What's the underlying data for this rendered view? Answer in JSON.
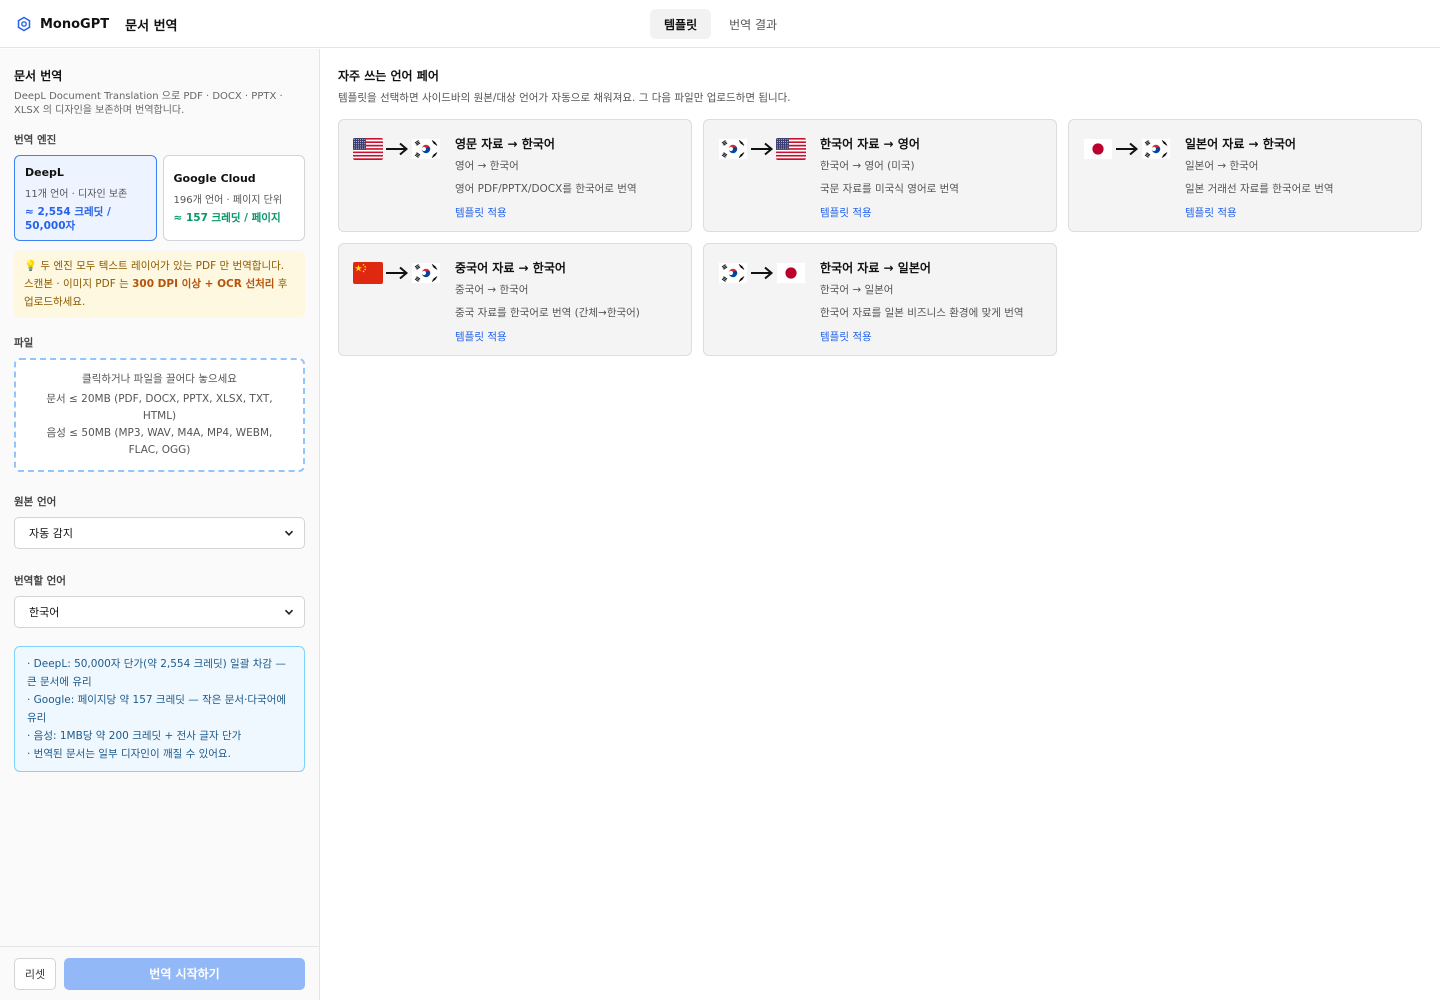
{
  "header": {
    "app_name": "MonoGPT",
    "page_title": "문서 번역",
    "tabs": [
      {
        "label": "템플릿",
        "active": true
      },
      {
        "label": "번역 결과",
        "active": false
      }
    ]
  },
  "sidebar": {
    "title": "문서 번역",
    "description": "DeepL Document Translation 으로 PDF · DOCX · PPTX · XLSX 의 디자인을 보존하며 번역합니다.",
    "engine_label": "번역 엔진",
    "engines": [
      {
        "name": "DeepL",
        "sub": "11개 언어 · 디자인 보존",
        "cost": "≈ 2,554 크레딧 / 50,000자",
        "selected": true
      },
      {
        "name": "Google Cloud",
        "sub": "196개 언어 · 페이지 단위",
        "cost": "≈ 157 크레딧 / 페이지",
        "selected": false
      }
    ],
    "warning": {
      "icon": "💡",
      "line1": "두 엔진 모두 텍스트 레이어가 있는 PDF 만 번역합니다. 스캔본 · 이미지 PDF 는 ",
      "strong": "300 DPI 이상 + OCR 선처리",
      "line2": " 후 업로드하세요."
    },
    "file_label": "파일",
    "dropzone": {
      "main": "클릭하거나 파일을 끌어다 놓으세요",
      "docs": "문서 ≤ 20MB (PDF, DOCX, PPTX, XLSX, TXT, HTML)",
      "audio": "음성 ≤ 50MB (MP3, WAV, M4A, MP4, WEBM, FLAC, OGG)"
    },
    "source_label": "원본 언어",
    "source_value": "자동 감지",
    "target_label": "번역할 언어",
    "target_value": "한국어",
    "info": [
      "· DeepL: 50,000자 단가(약 2,554 크레딧) 일괄 차감 — 큰 문서에 유리",
      "· Google: 페이지당 약 157 크레딧 — 작은 문서·다국어에 유리",
      "· 음성: 1MB당 약 200 크레딧 + 전사 글자 단가",
      "· 번역된 문서는 일부 디자인이 깨질 수 있어요."
    ],
    "reset_label": "리셋",
    "start_label": "번역 시작하기"
  },
  "main": {
    "title": "자주 쓰는 언어 페어",
    "description": "템플릿을 선택하면 사이드바의 원본/대상 언어가 자동으로 채워져요. 그 다음 파일만 업로드하면 됩니다.",
    "apply_label": "템플릿 적용",
    "templates": [
      {
        "from": "us",
        "to": "kr",
        "title": "영문 자료 → 한국어",
        "pair": "영어 → 한국어",
        "desc": "영어 PDF/PPTX/DOCX를 한국어로 번역"
      },
      {
        "from": "kr",
        "to": "us",
        "title": "한국어 자료 → 영어",
        "pair": "한국어 → 영어 (미국)",
        "desc": "국문 자료를 미국식 영어로 번역"
      },
      {
        "from": "jp",
        "to": "kr",
        "title": "일본어 자료 → 한국어",
        "pair": "일본어 → 한국어",
        "desc": "일본 거래선 자료를 한국어로 번역"
      },
      {
        "from": "cn",
        "to": "kr",
        "title": "중국어 자료 → 한국어",
        "pair": "중국어 → 한국어",
        "desc": "중국 자료를 한국어로 번역 (간체→한국어)"
      },
      {
        "from": "kr",
        "to": "jp",
        "title": "한국어 자료 → 일본어",
        "pair": "한국어 → 일본어",
        "desc": "한국어 자료를 일본 비즈니스 환경에 맞게 번역"
      }
    ]
  },
  "colors": {
    "accent": "#2563eb",
    "start_button": "#93b8f7",
    "selected_engine_bg": "#eef4ff",
    "info_bg": "#eff8ff",
    "warn_bg": "#fff8e1"
  }
}
